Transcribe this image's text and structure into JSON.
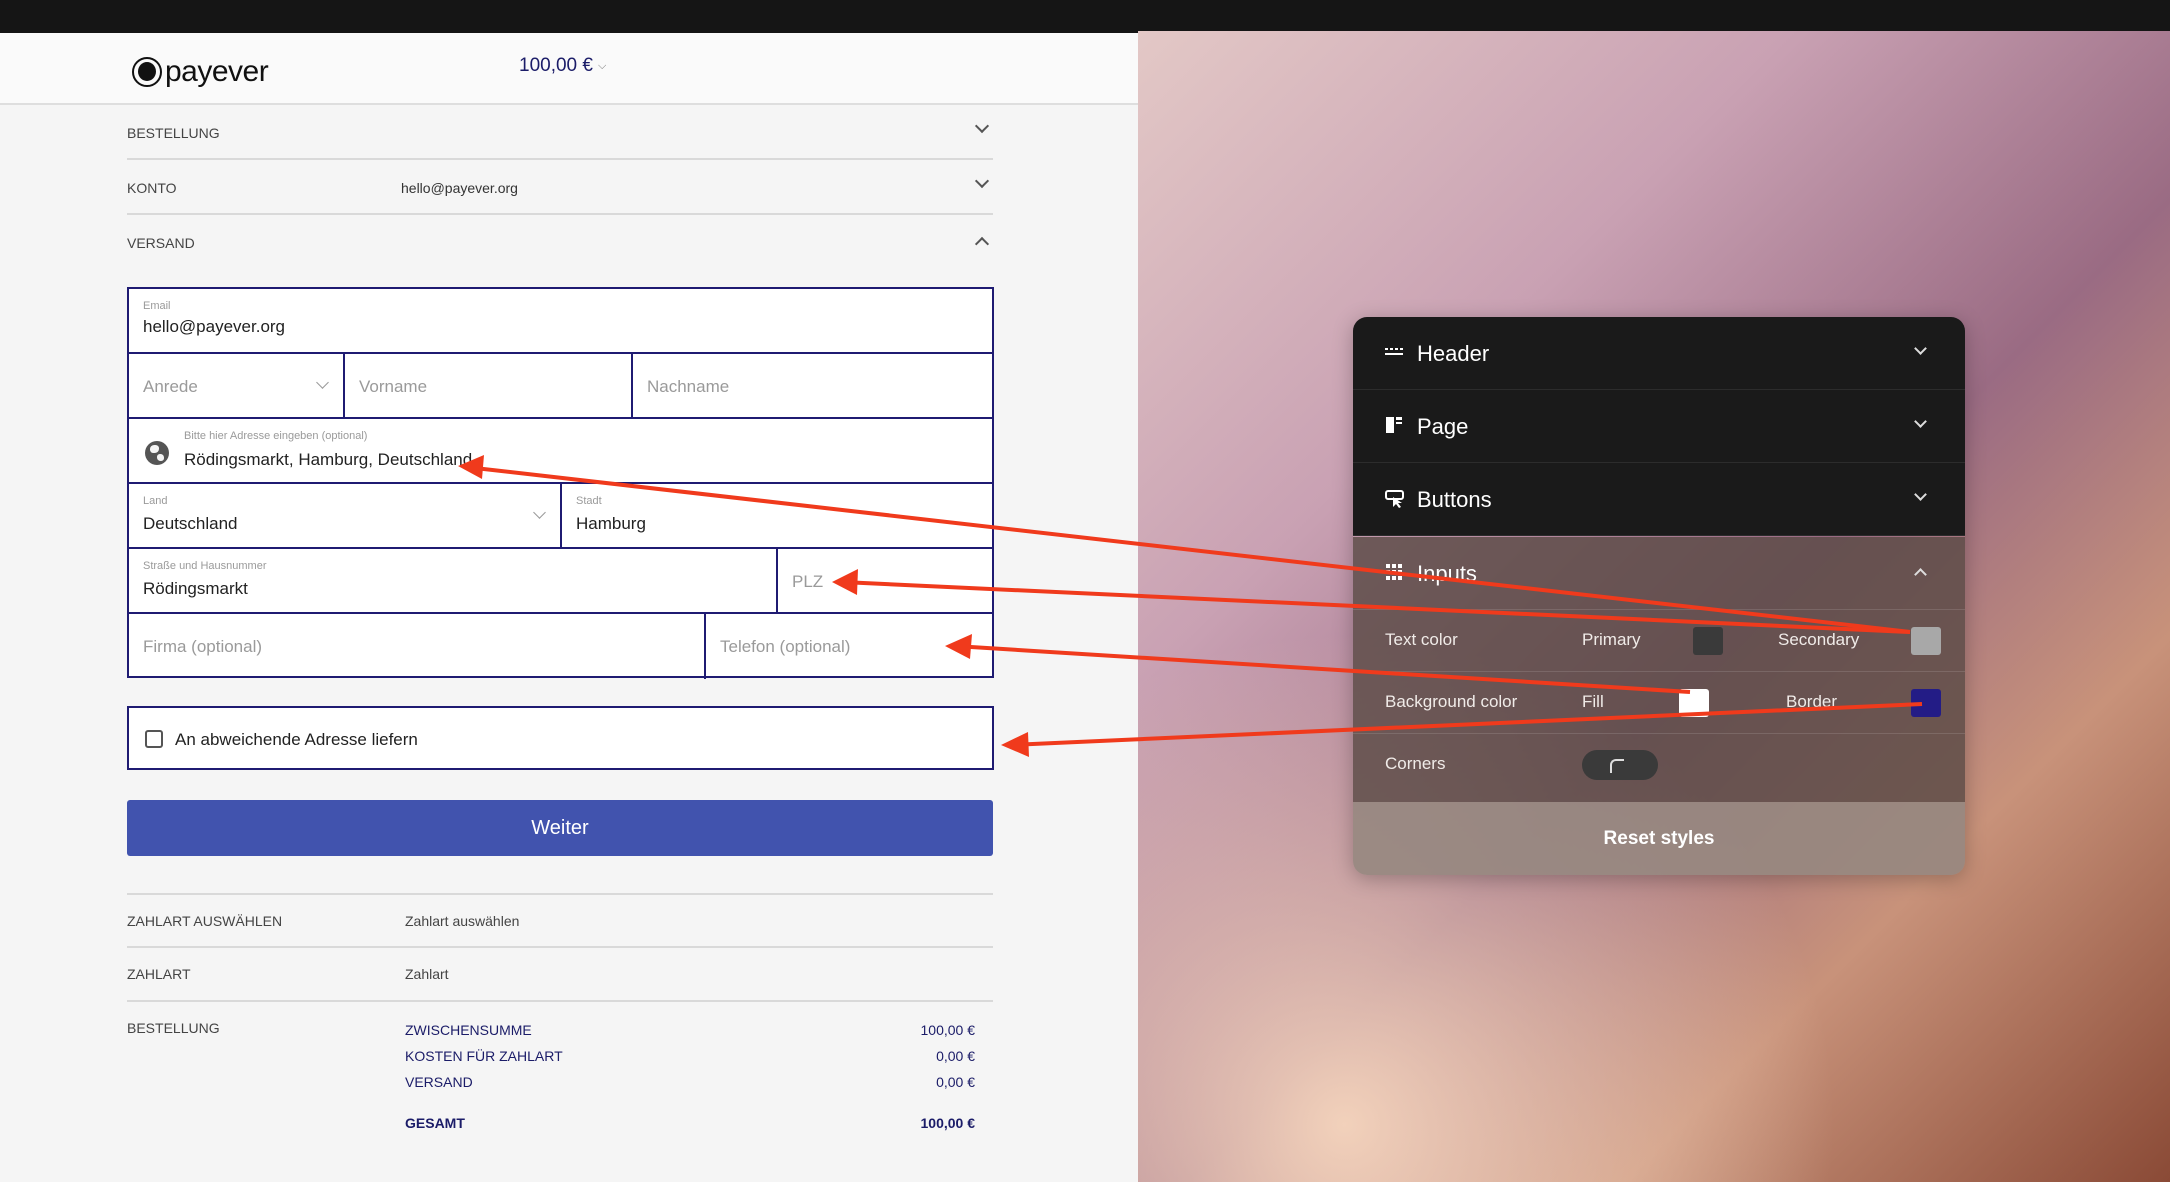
{
  "checkout": {
    "logo_text": "payever",
    "header_amount": "100,00 €",
    "sections": {
      "bestellung": "BESTELLUNG",
      "konto": "KONTO",
      "konto_value": "hello@payever.org",
      "versand": "VERSAND"
    },
    "form": {
      "email_label": "Email",
      "email_value": "hello@payever.org",
      "anrede_placeholder": "Anrede",
      "vorname_placeholder": "Vorname",
      "nachname_placeholder": "Nachname",
      "address_label": "Bitte hier Adresse eingeben (optional)",
      "address_value": "Rödingsmarkt, Hamburg, Deutschland",
      "land_label": "Land",
      "land_value": "Deutschland",
      "stadt_label": "Stadt",
      "stadt_value": "Hamburg",
      "strasse_label": "Straße und Hausnummer",
      "strasse_value": "Rödingsmarkt",
      "plz_placeholder": "PLZ",
      "firma_placeholder": "Firma (optional)",
      "telefon_placeholder": "Telefon (optional)"
    },
    "checkbox_label": "An abweichende Adresse liefern",
    "weiter_label": "Weiter",
    "summary": {
      "zahlart_auswaehlen_label": "ZAHLART AUSWÄHLEN",
      "zahlart_auswaehlen_value": "Zahlart auswählen",
      "zahlart_label": "ZAHLART",
      "zahlart_value": "Zahlart",
      "bestellung_label": "BESTELLUNG",
      "totals": [
        {
          "name": "ZWISCHENSUMME",
          "value": "100,00 €"
        },
        {
          "name": "KOSTEN FÜR ZAHLART",
          "value": "0,00 €"
        },
        {
          "name": "VERSAND",
          "value": "0,00 €"
        }
      ],
      "grand_total": {
        "name": "GESAMT",
        "value": "100,00 €"
      }
    }
  },
  "panel": {
    "rows": [
      {
        "title": "Header",
        "icon": "header-icon"
      },
      {
        "title": "Page",
        "icon": "page-icon"
      },
      {
        "title": "Buttons",
        "icon": "buttons-icon"
      },
      {
        "title": "Inputs",
        "icon": "inputs-icon"
      }
    ],
    "text_color_label": "Text color",
    "primary_label": "Primary",
    "secondary_label": "Secondary",
    "background_color_label": "Background color",
    "fill_label": "Fill",
    "border_label": "Border",
    "corners_label": "Corners",
    "reset_label": "Reset styles",
    "colors": {
      "primary": "#3a3a3a",
      "secondary": "#a8a8a8",
      "fill": "#ffffff",
      "border": "#231c86",
      "arrow": "#f03a1c"
    }
  }
}
